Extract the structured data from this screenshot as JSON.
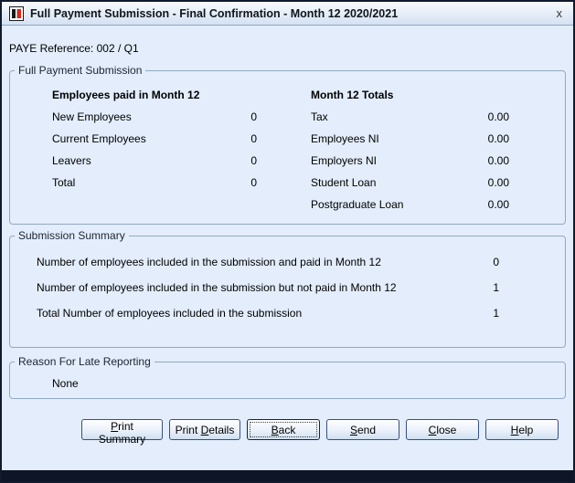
{
  "window": {
    "title": "Full Payment Submission - Final Confirmation - Month 12 2020/2021",
    "close_glyph": "x"
  },
  "paye_reference": "PAYE Reference: 002 / Q1",
  "fps": {
    "legend": "Full Payment Submission",
    "left": {
      "header": "Employees paid in Month 12",
      "rows": [
        {
          "label": "New Employees",
          "value": "0"
        },
        {
          "label": "Current Employees",
          "value": "0"
        },
        {
          "label": "Leavers",
          "value": "0"
        },
        {
          "label": "Total",
          "value": "0"
        }
      ]
    },
    "right": {
      "header": "Month 12 Totals",
      "rows": [
        {
          "label": "Tax",
          "value": "0.00"
        },
        {
          "label": "Employees NI",
          "value": "0.00"
        },
        {
          "label": "Employers NI",
          "value": "0.00"
        },
        {
          "label": "Student Loan",
          "value": "0.00"
        },
        {
          "label": "Postgraduate Loan",
          "value": "0.00"
        }
      ]
    }
  },
  "summary": {
    "legend": "Submission Summary",
    "rows": [
      {
        "label": "Number of employees included in the submission and paid in Month 12",
        "value": "0"
      },
      {
        "label": "Number of employees included in the submission but not paid in Month 12",
        "value": "1"
      },
      {
        "label": "Total Number of employees included in the submission",
        "value": "1"
      }
    ]
  },
  "late_reporting": {
    "legend": "Reason For Late Reporting",
    "value": "None"
  },
  "buttons": [
    {
      "label": "Print Summary"
    },
    {
      "label": "Print Details"
    },
    {
      "label": "Back"
    },
    {
      "label": "Send"
    },
    {
      "label": "Close"
    },
    {
      "label": "Help"
    }
  ],
  "colors": {
    "dialog_bg": "#e3edfb",
    "frame": "#101a2e",
    "group_border": "#93a9c6",
    "button_border": "#39507c",
    "icon_red": "#d42b1e"
  }
}
